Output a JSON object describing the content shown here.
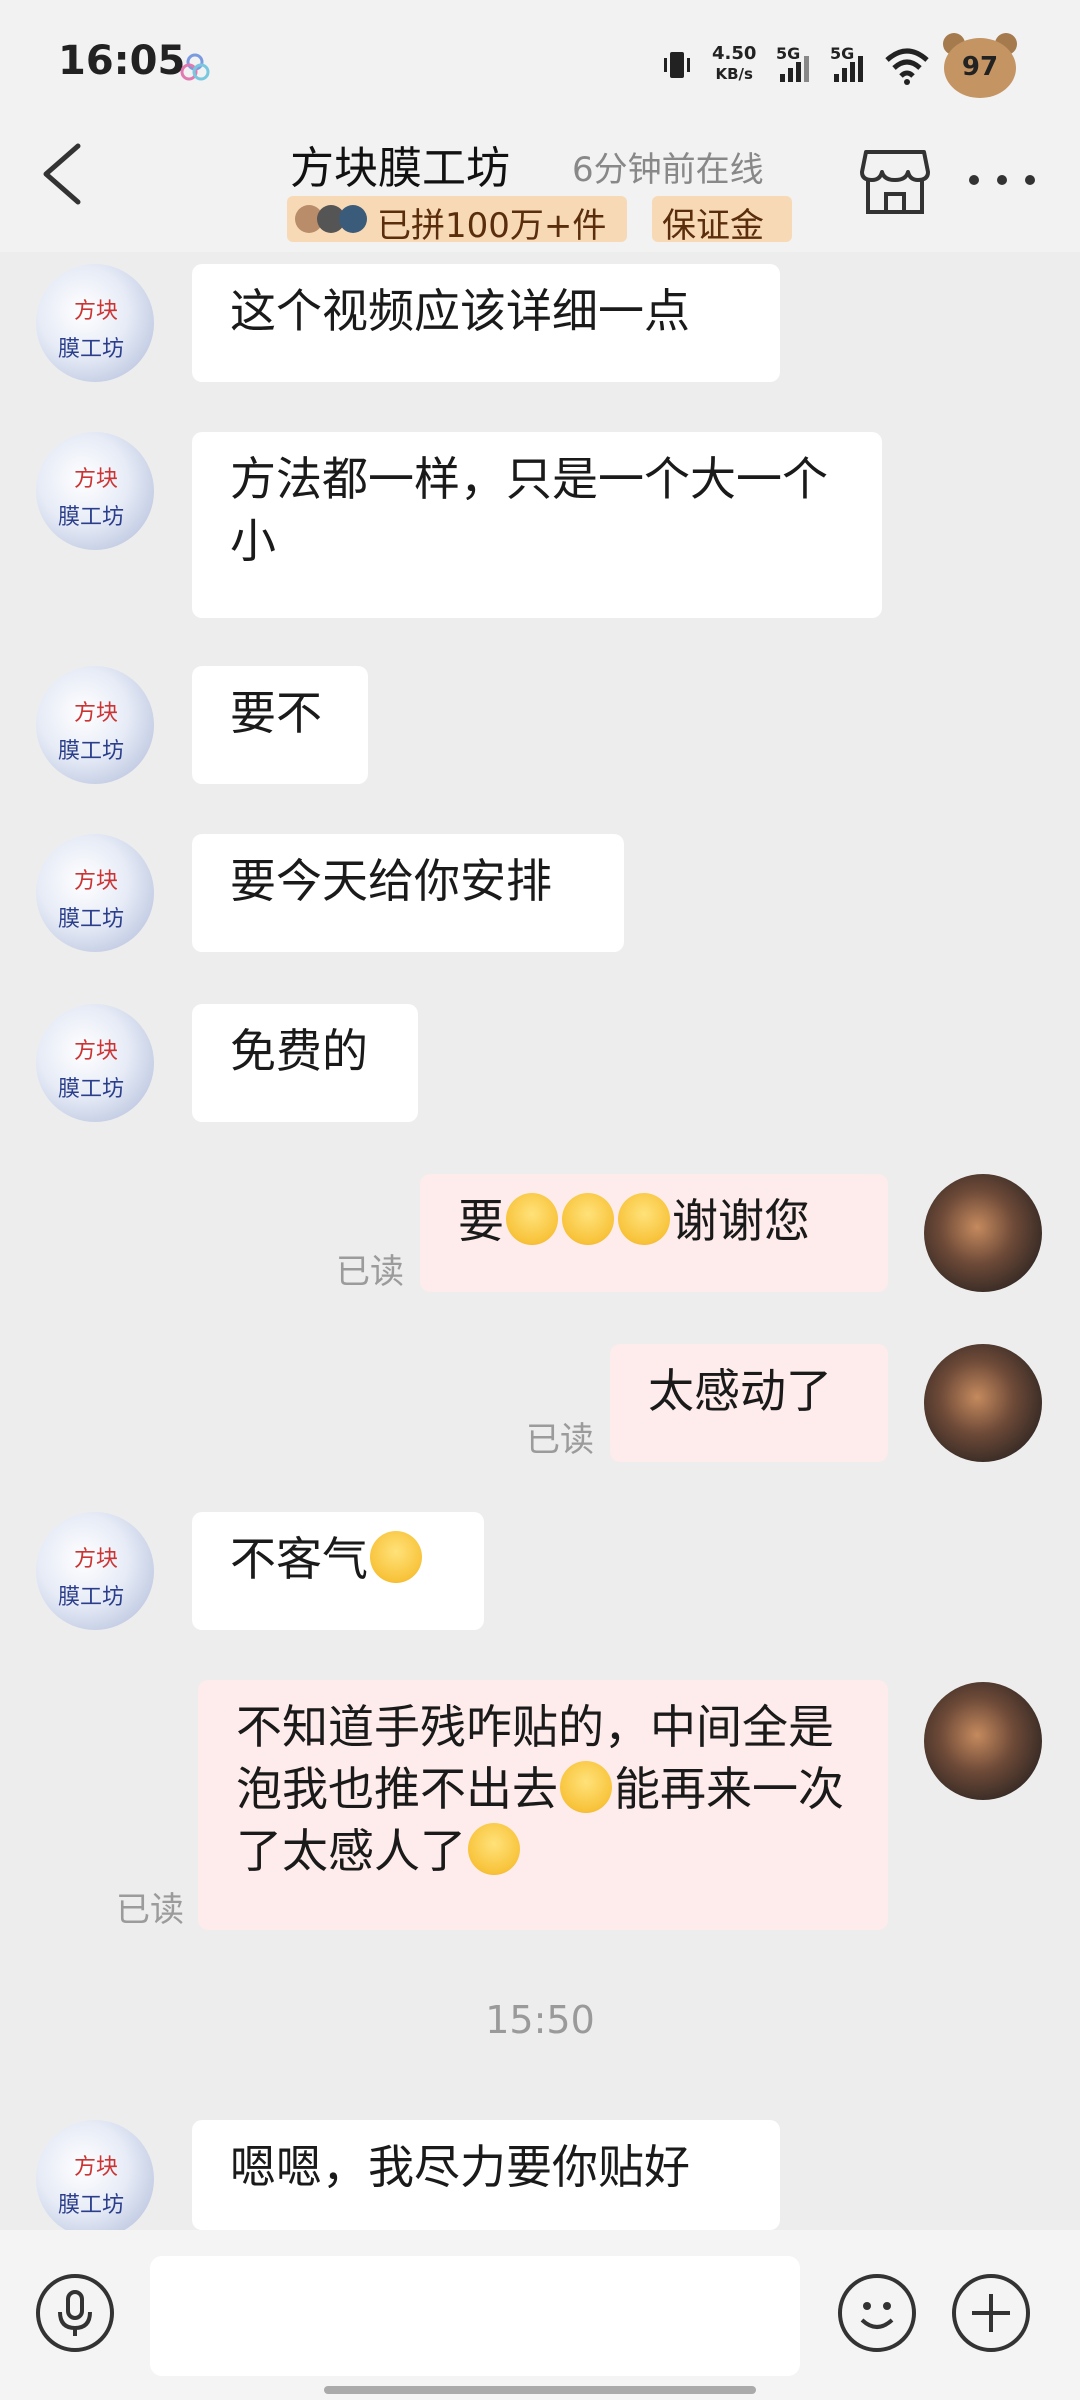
{
  "status_bar": {
    "time": "16:05",
    "net_speed_value": "4.50",
    "net_speed_unit": "KB/s",
    "signal_1_label": "5G",
    "signal_2_label": "5G",
    "battery": "97"
  },
  "header": {
    "shop_name": "方块膜工坊",
    "online_status": "6分钟前在线",
    "sales_badge": "已拼100万+件",
    "deposit_badge": "保证金"
  },
  "messages": [
    {
      "side": "in",
      "text": "这个视频应该详细一点"
    },
    {
      "side": "in",
      "text": "方法都一样，只是一个大一个小"
    },
    {
      "side": "in",
      "text": "要不"
    },
    {
      "side": "in",
      "text": "要今天给你安排"
    },
    {
      "side": "in",
      "text": "免费的"
    },
    {
      "side": "out",
      "text_a": "要",
      "text_b": "谢谢您",
      "emoji": "crying-face-icon",
      "read": "已读"
    },
    {
      "side": "out",
      "text": "太感动了",
      "read": "已读"
    },
    {
      "side": "in",
      "text": "不客气",
      "emoji": "grinning-face-icon"
    },
    {
      "side": "out",
      "text_a": "不知道手残咋贴的，中间全是泡我也推不出去",
      "text_b": "能再来一次了太感人了",
      "emoji_1": "laughing-crying-face-icon",
      "emoji_2": "pleading-face-icon",
      "read": "已读"
    },
    {
      "side": "in",
      "text": "嗯嗯，我尽力要你贴好"
    }
  ],
  "timestamp": "15:50",
  "input": {
    "placeholder": ""
  },
  "colors": {
    "incoming_bubble": "#ffffff",
    "outgoing_bubble": "#fdeceb",
    "badge": "#f7d9b5",
    "background": "#ededed"
  }
}
